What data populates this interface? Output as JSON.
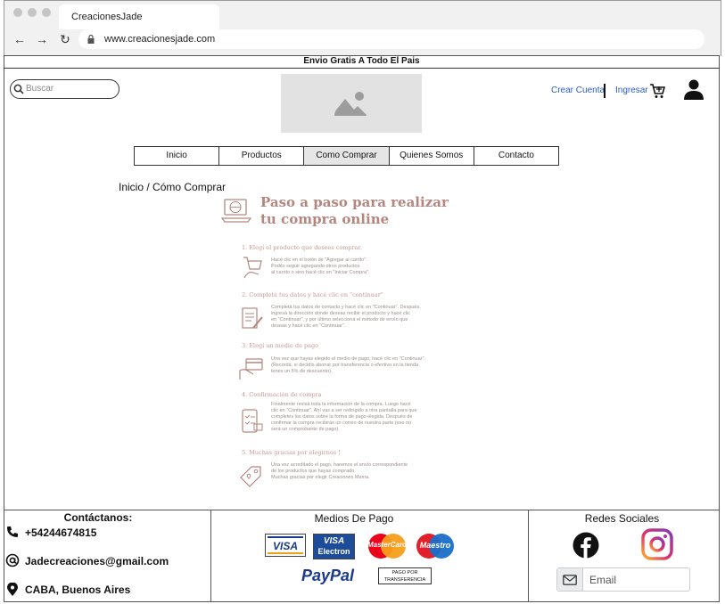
{
  "browser": {
    "tab_title": "CreacionesJade",
    "url": "www.creacionesjade.com"
  },
  "banner": "Envio Gratis A Todo El Pais",
  "header": {
    "search_placeholder": "Buscar",
    "create_account": "Crear Cuenta",
    "login": "Ingresar"
  },
  "nav": [
    "Inicio",
    "Productos",
    "Como Comprar",
    "Quienes Somos",
    "Contacto"
  ],
  "breadcrumb": {
    "home": "Inicio",
    "sep": " / ",
    "current": "Cómo Comprar"
  },
  "steps": {
    "title_line1": "Paso a paso para realizar",
    "title_line2": "tu compra online",
    "items": [
      {
        "heading": "1. Elegí el producto que desees comprar.",
        "lines": [
          "Hacé clic en el botón de \"Agregar al carrito\".",
          "Podés seguir agregando otros productos",
          "al carrito o sino hacé clic en \"Iniciar Compra\"."
        ]
      },
      {
        "heading": "2. Completá tus datos y hacé clic en \"continuar\"",
        "lines": [
          "Completá tus datos de contacto y hacé clic en \"Continuar\". Después,",
          "ingresá la dirección donde deseas recibir el producto y hacé clic",
          "en \"Continuar\", y por último seleccioná el método de envío que",
          "deseas y hacé clic en \"Continuar\"."
        ]
      },
      {
        "heading": "3. Elegí un medio de pago",
        "lines": [
          "Una vez que hayas elegido el medio de pago, hacé clic en \"Continuar\".",
          "(Recordá, si decidís abonar por transferencia o efectivo en la tienda",
          "tenés un 5% de descuento)."
        ]
      },
      {
        "heading": "4. Confirmación de compra",
        "lines": [
          "Finalmente revisá toda la información de la compra. Luego hacé",
          "clic en \"Continuar\". Ahí vas a ser redirigido a otra pantalla para que",
          "completes los datos sobre la forma de pago elegida. Después de",
          "confirmar la compra recibirás un correo de nuestra parte (ese no",
          "será un comprobante de pago)."
        ]
      },
      {
        "heading": "5. Muchas gracias por elegirnos !",
        "lines": [
          "Una vez acreditado el pago, haremos el envío correspondiente",
          "de los productos que hayas comprado.",
          "Muchas gracias por elegir Creaciones Mama."
        ]
      }
    ]
  },
  "footer": {
    "contact_title": "Contáctanos:",
    "phone": "+54244674815",
    "email": "Jadecreaciones@gmail.com",
    "location": "CABA, Buenos Aires",
    "payments_title": "Medios De Pago",
    "payments": {
      "visa": "VISA",
      "visa_electron_1": "VISA",
      "visa_electron_2": "Electron",
      "mastercard": "MasterCard",
      "maestro": "Maestro",
      "paypal": "PayPal",
      "transfer_1": "PAGO POR",
      "transfer_2": "TRANSFERENCIA"
    },
    "social_title": "Redes Sociales",
    "email_placeholder": "Email"
  },
  "colors": {
    "link": "#2a5dc3",
    "accent_rose": "#b4867f",
    "facebook": "#111111",
    "instagram": "#c13584"
  }
}
